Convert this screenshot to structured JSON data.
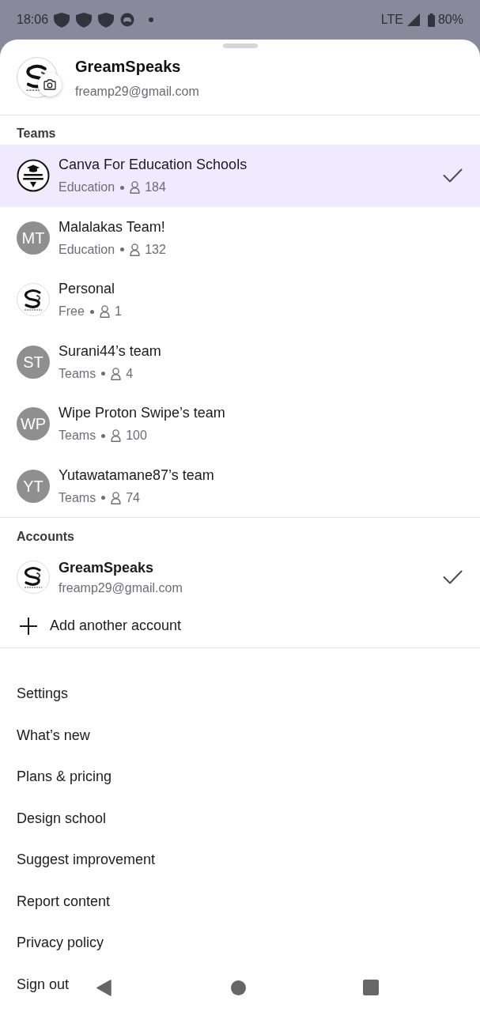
{
  "status_bar": {
    "time": "18:06",
    "network": "LTE",
    "battery": "80%"
  },
  "account": {
    "name": "GreamSpeaks",
    "email": "freamp29@gmail.com",
    "avatar": {
      "kind": "monogram"
    }
  },
  "teams": {
    "heading": "Teams",
    "items": [
      {
        "name": "Canva For Education Schools",
        "plan": "Education",
        "members": "184",
        "avatar": {
          "kind": "badge"
        },
        "selected": true
      },
      {
        "name": "Malalakas Team!",
        "plan": "Education",
        "members": "132",
        "avatar": {
          "kind": "initials",
          "text": "MT"
        },
        "selected": false
      },
      {
        "name": "Personal",
        "plan": "Free",
        "members": "1",
        "avatar": {
          "kind": "monogram"
        },
        "selected": false
      },
      {
        "name": "Surani44’s team",
        "plan": "Teams",
        "members": "4",
        "avatar": {
          "kind": "initials",
          "text": "ST"
        },
        "selected": false
      },
      {
        "name": "Wipe Proton Swipe’s team",
        "plan": "Teams",
        "members": "100",
        "avatar": {
          "kind": "initials",
          "text": "WP"
        },
        "selected": false
      },
      {
        "name": "Yutawatamane87’s team",
        "plan": "Teams",
        "members": "74",
        "avatar": {
          "kind": "initials",
          "text": "YT"
        },
        "selected": false
      }
    ]
  },
  "accounts": {
    "heading": "Accounts",
    "items": [
      {
        "name": "GreamSpeaks",
        "email": "freamp29@gmail.com",
        "avatar": {
          "kind": "monogram"
        },
        "selected": true
      }
    ],
    "add_label": "Add another account"
  },
  "menu": [
    {
      "label": "Settings"
    },
    {
      "label": "What’s new"
    },
    {
      "label": "Plans & pricing"
    },
    {
      "label": "Design school"
    },
    {
      "label": "Suggest improvement"
    },
    {
      "label": "Report content"
    },
    {
      "label": "Privacy policy"
    },
    {
      "label": "Sign out"
    }
  ]
}
